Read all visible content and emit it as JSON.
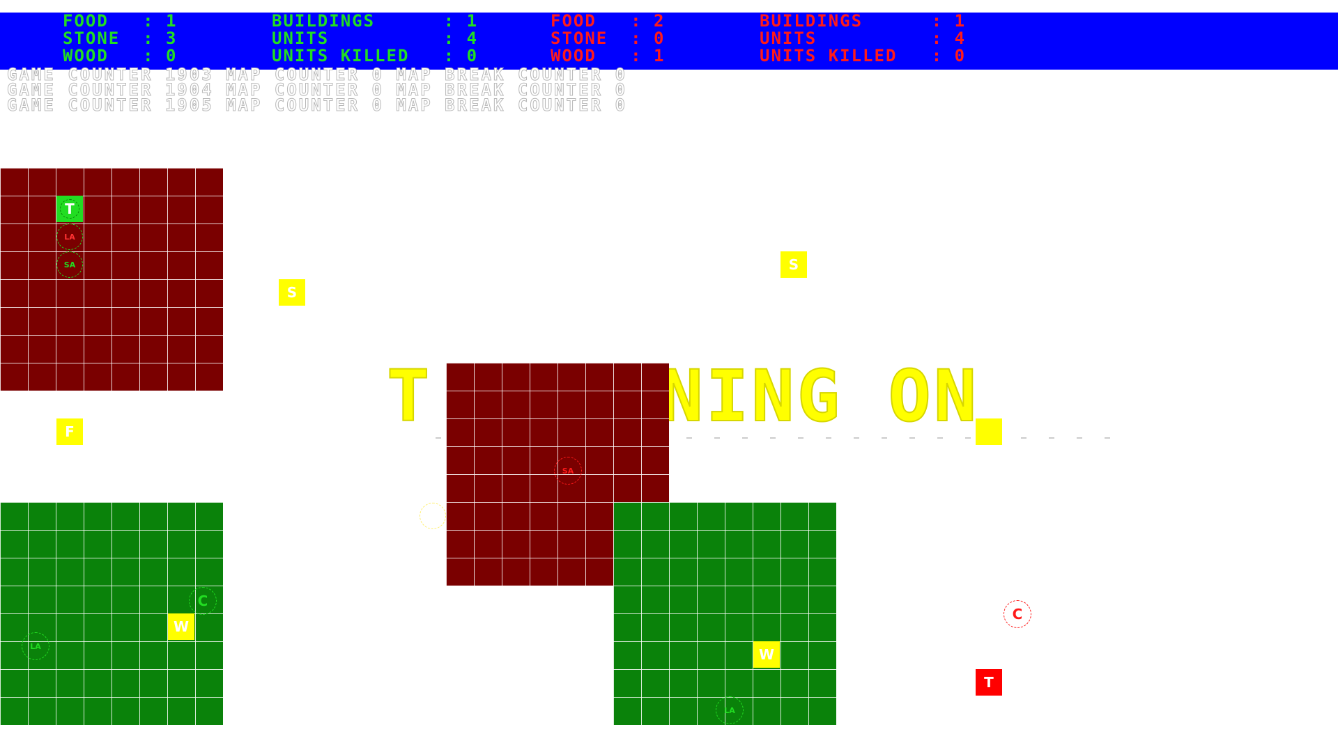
{
  "colors": {
    "hud_bg": "#0000ff",
    "player1": "#22dd22",
    "player2": "#ff1a1a",
    "red_territory": "#7a0000",
    "green_territory": "#0a820a",
    "resource_tile": "#ffff00",
    "banner": "#ffff00"
  },
  "hud": {
    "player1": {
      "food": "FOOD   : 1",
      "stone": "STONE  : 3",
      "wood": "WOOD   : 0",
      "buildings": "BUILDINGS      : 1",
      "units": "UNITS          : 4",
      "units_killed": "UNITS KILLED   : 0"
    },
    "player2": {
      "food": "FOOD   : 2",
      "stone": "STONE  : 0",
      "wood": "WOOD   : 1",
      "buildings": "BUILDINGS      : 1",
      "units": "UNITS          : 4",
      "units_killed": "UNITS KILLED   : 0"
    }
  },
  "counters": [
    "GAME COUNTER 1903 MAP COUNTER 0 MAP BREAK COUNTER 0",
    "GAME COUNTER 1904 MAP COUNTER 0 MAP BREAK COUNTER 0",
    "GAME COUNTER 1905 MAP COUNTER 0 MAP BREAK COUNTER 0"
  ],
  "banner": "T     NING ON",
  "tiles": {
    "p1_town": "T",
    "stone_1": "S",
    "stone_2": "S",
    "food_1": "F",
    "wood_1": "W",
    "wood_2": "W",
    "p2_town": "T"
  },
  "units": {
    "p1_unit_la_top": "LA",
    "p1_unit_sa": "SA",
    "p1_unit_c": "C",
    "p1_unit_la_left": "LA",
    "p1_unit_la_bottom": "LA",
    "p2_unit_sa": "SA",
    "p2_unit_c": "C"
  }
}
